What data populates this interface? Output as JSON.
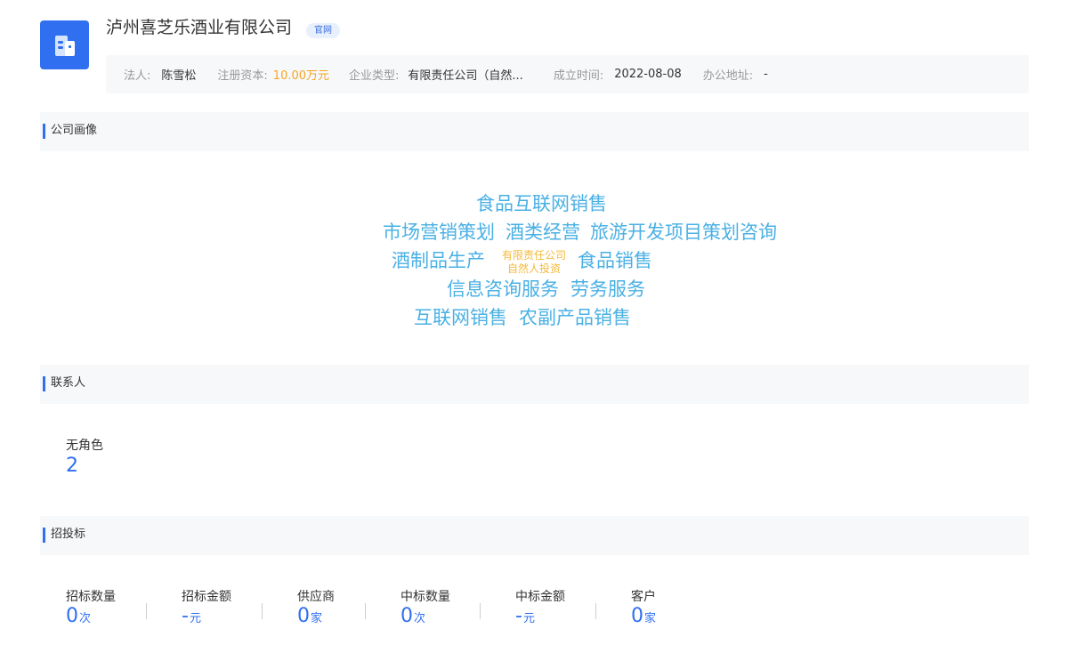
{
  "company": {
    "name": "泸州喜芝乐酒业有限公司",
    "official_tag": "官网"
  },
  "info_bar": {
    "legal_rep_label": "法人:",
    "legal_rep_value": "陈雪松",
    "capital_label": "注册资本:",
    "capital_value": "10.00万元",
    "type_label": "企业类型:",
    "type_value": "有限责任公司（自然...",
    "founded_label": "成立时间:",
    "founded_value": "2022-08-08",
    "address_label": "办公地址:",
    "address_value": "-"
  },
  "sections": {
    "portrait": "公司画像",
    "contacts": "联系人",
    "bidding": "招投标"
  },
  "word_cloud": {
    "words": [
      "食品互联网销售",
      "市场营销策划",
      "酒类经营",
      "旅游开发项目策划咨询",
      "酒制品生产",
      "食品销售",
      "信息咨询服务",
      "劳务服务",
      "互联网销售",
      "农副产品销售"
    ],
    "small_tag_line1": "有限责任公司",
    "small_tag_line2": "自然人投资",
    "colors": {
      "word": "#4ab0e4",
      "tag": "#f5b93a"
    }
  },
  "contacts": {
    "role_label": "无角色",
    "role_count": "2"
  },
  "bidding_stats": [
    {
      "label": "招标数量",
      "value": "0",
      "unit": "次"
    },
    {
      "label": "招标金额",
      "value": "-",
      "unit": "元"
    },
    {
      "label": "供应商",
      "value": "0",
      "unit": "家"
    },
    {
      "label": "中标数量",
      "value": "0",
      "unit": "次"
    },
    {
      "label": "中标金额",
      "value": "-",
      "unit": "元"
    },
    {
      "label": "客户",
      "value": "0",
      "unit": "家"
    }
  ],
  "icons": {
    "logo": "building-icon"
  },
  "colors": {
    "accent": "#2f6ff0",
    "money": "#f5a623",
    "muted": "#999999"
  }
}
